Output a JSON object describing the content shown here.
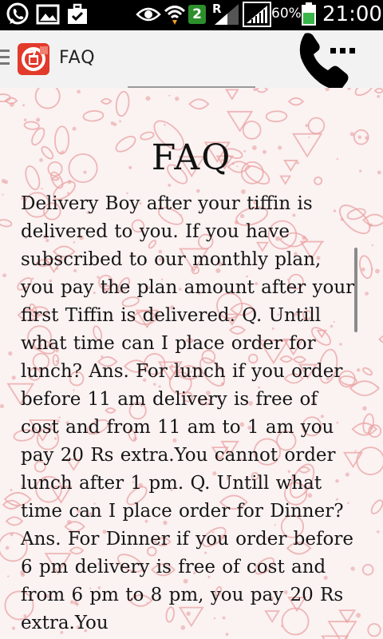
{
  "status_bar": {
    "notification_badge": "2",
    "roaming_indicator": "R",
    "battery_percent": "60%",
    "time": "21:00",
    "icons": [
      "whatsapp-icon",
      "gallery-icon",
      "briefcase-icon",
      "eye-icon",
      "wifi-icon",
      "signal-icon",
      "battery-icon"
    ]
  },
  "action_bar": {
    "title": "FAQ",
    "logo_icon": "tiffin-logo-icon",
    "menu_icon": "drawer-menu-icon",
    "call_icon": "phone-call-icon"
  },
  "content": {
    "heading": "FAQ",
    "body": "Delivery Boy after your tiffin is delivered to you. If you have subscribed to our monthly plan, you pay the plan amount after your first Tiffin is delivered.  Q. Untill what time can I place order for lunch? Ans. For lunch if you order before 11 am delivery is free of cost and from 11 am to 1 am you pay 20 Rs extra.You cannot order lunch after 1 pm.  Q. Untill what time can I place order for Dinner? Ans. For Dinner  if you order before 6 pm delivery is free of cost and from 6 pm  to 8 pm,  you pay 20 Rs extra.You"
  },
  "colors": {
    "status_bar_bg": "#000000",
    "action_bar_bg": "#f2f2f2",
    "logo_red": "#e23a2b",
    "badge_green": "#2c8f2c",
    "pattern_pink": "#e9a2a2",
    "content_bg": "#fbf2f2"
  }
}
